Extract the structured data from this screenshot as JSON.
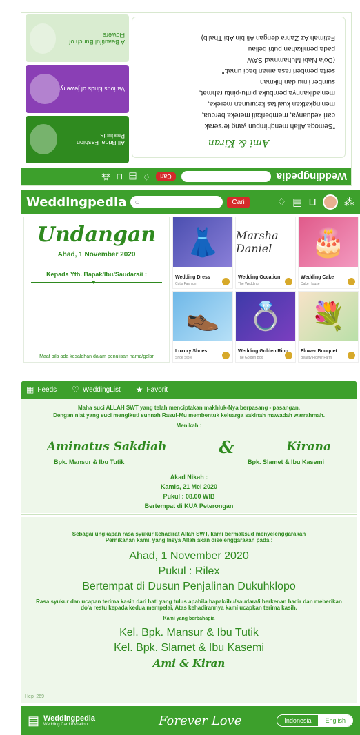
{
  "flipped": {
    "brand": "Weddingpedia",
    "cari": "Cari",
    "signature": "Ami & Kiran",
    "letter_lines": [
      "\"Semoga Allah menghimpun yang terserak",
      "dari keduanya, memberkati mereka berdua,",
      "meningkatkan kualitas keturunan mereka,",
      "menjadikannya pembuka pintu-pintu rahmat,",
      "sumber ilmu dan hikmah",
      "serta pemberi rasa aman bagi umat.\"",
      "(Do'a Nabi Muhammad SAW",
      "pada pernikahan putri beliau",
      "Fatimah Az Zahra dengan Ali bin Abi Thalib)"
    ],
    "cards": [
      "All Bridal Fashion Products",
      "Various kinds of jewelry",
      "A Beautiful Bunch of Flowers"
    ]
  },
  "header": {
    "brand": "Weddingpedia",
    "cari": "Cari"
  },
  "undangan": {
    "title": "Undangan",
    "date": "Ahad, 1 November 2020",
    "kepada": "Kepada Yth. Bapak/Ibu/Saudara/i :",
    "footer": "Maaf bila ada kesalahan dalam penulisan nama/gelar"
  },
  "products": [
    {
      "name": "Wedding Dress",
      "sub": "Cut's Fashion",
      "icon": "👗"
    },
    {
      "name": "Wedding Occation",
      "sub": "The Wedding",
      "icon": "Marsha Daniel"
    },
    {
      "name": "Wedding Cake",
      "sub": "Cake House",
      "icon": "🎂"
    },
    {
      "name": "Luxury Shoes",
      "sub": "Shoe Store",
      "icon": "👞"
    },
    {
      "name": "Wedding Golden Ring",
      "sub": "The Golden Box",
      "icon": "💍"
    },
    {
      "name": "Flower Bouquet",
      "sub": "Beauty Flower Farm",
      "icon": "💐"
    }
  ],
  "tabs": {
    "feeds": "Feeds",
    "weddinglist": "WeddingList",
    "favorit": "Favorit"
  },
  "invitation": {
    "intro1": "Maha suci ALLAH SWT yang telah menciptakan makhluk-Nya berpasang - pasangan.",
    "intro2": "Dengan niat yang suci mengikuti sunnah Rasul-Mu  membentuk keluarga sakinah mawadah warrahmah.",
    "menikah": "Menikah :",
    "bride": "Aminatus Sakdiah",
    "amp": "&",
    "groom": "Kirana",
    "bride_parents": "Bpk. Mansur & Ibu Tutik",
    "groom_parents": "Bpk. Slamet & Ibu Kasemi",
    "akad_title": "Akad Nikah :",
    "akad_date": "Kamis, 21 Mei 2020",
    "akad_time": "Pukul : 08.00 WIB",
    "akad_place": "Bertempat di KUA Peterongan"
  },
  "reception": {
    "intro1": "Sebagai ungkapan rasa syukur kehadirat Allah SWT, kami bermaksud menyelenggarakan",
    "intro2": "Pernikahan kami, yang Insya Allah akan diselenggarakan pada :",
    "date": "Ahad, 1 November 2020",
    "time": "Pukul : Rilex",
    "place": "Bertempat di Dusun Penjalinan Dukuhklopo",
    "thanks1": "Rasa syukur dan ucapan terima kasih dari hati yang tulus apabila bapak/ibu/saudara/i berkenan hadir dan meberikan",
    "thanks2": "do'a restu kepada kedua mempelai, Atas kehadirannya kami ucapkan terima kasih.",
    "happy": "Kami yang berbahagia",
    "family1": "Kel. Bpk. Mansur & Ibu Tutik",
    "family2": "Kel. Bpk. Slamet & Ibu Kasemi",
    "signature": "Ami & Kiran",
    "hepi": "Hepi 269"
  },
  "footer": {
    "brand": "Weddingpedia",
    "tagline": "Wedding Card Invitation",
    "forever": "Forever Love",
    "lang_active": "Indonesia",
    "lang_other": "English"
  }
}
